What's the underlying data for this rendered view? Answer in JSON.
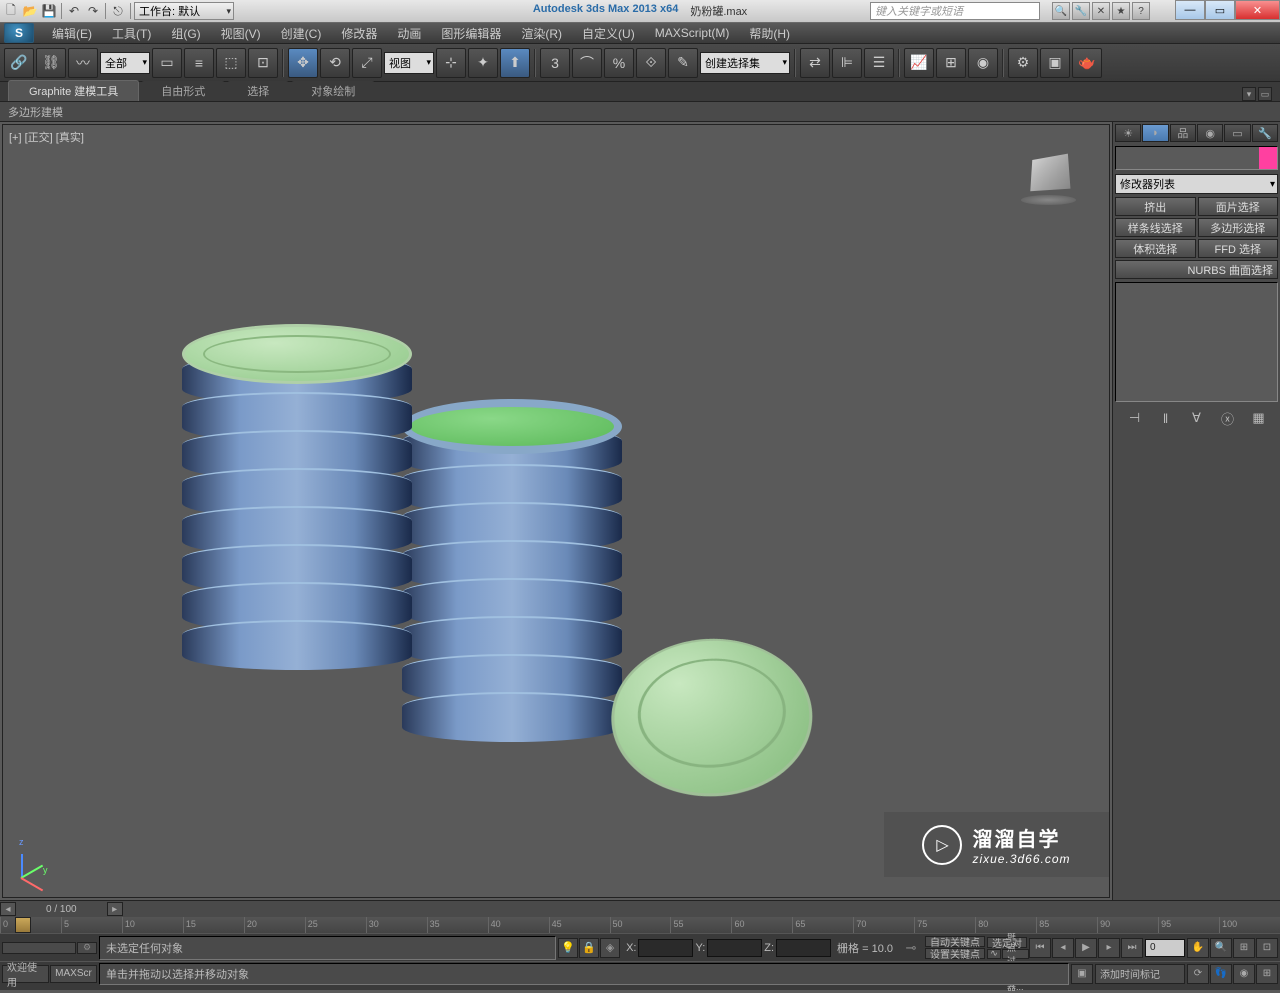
{
  "titlebar": {
    "workspace_label": "工作台: 默认",
    "app_title": "Autodesk 3ds Max  2013 x64",
    "file_title": "奶粉罐.max",
    "search_placeholder": "键入关键字或短语"
  },
  "menus": {
    "edit": "编辑(E)",
    "tools": "工具(T)",
    "group": "组(G)",
    "views": "视图(V)",
    "create": "创建(C)",
    "modifiers": "修改器",
    "animation": "动画",
    "graph": "图形编辑器",
    "render": "渲染(R)",
    "customize": "自定义(U)",
    "maxscript": "MAXScript(M)",
    "help": "帮助(H)"
  },
  "toolbar": {
    "select_filter": "全部",
    "view_label": "视图",
    "named_set": "创建选择集"
  },
  "ribbon": {
    "tab_graphite": "Graphite 建模工具",
    "tab_freeform": "自由形式",
    "tab_select": "选择",
    "tab_paint": "对象绘制",
    "panel_poly": "多边形建模"
  },
  "viewport": {
    "label": "[+] [正交] [真实]"
  },
  "command_panel": {
    "modifier_list": "修改器列表",
    "btn_extrude": "挤出",
    "btn_face_select": "面片选择",
    "btn_spline_select": "样条线选择",
    "btn_poly_select": "多边形选择",
    "btn_vol_select": "体积选择",
    "btn_ffd_select": "FFD 选择",
    "btn_nurbs": "NURBS 曲面选择"
  },
  "timeline": {
    "frame_display": "0 / 100",
    "ticks": [
      "0",
      "5",
      "10",
      "15",
      "20",
      "25",
      "30",
      "35",
      "40",
      "45",
      "50",
      "55",
      "60",
      "65",
      "70",
      "75",
      "80",
      "85",
      "90",
      "95",
      "100"
    ]
  },
  "status": {
    "welcome": "欢迎使用",
    "maxscript": "MAXScr",
    "no_selection": "未选定任何对象",
    "prompt": "单击并拖动以选择并移动对象",
    "x_label": "X:",
    "y_label": "Y:",
    "z_label": "Z:",
    "grid": "栅格 = 10.0",
    "autokey": "自动关键点",
    "setkey": "设置关键点",
    "selected": "选定对",
    "keyfilter": "关键点过滤器...",
    "add_time": "添加时间标记",
    "frame_current": "0"
  },
  "watermark": {
    "line1": "溜溜自学",
    "line2": "zixue.3d66.com"
  }
}
